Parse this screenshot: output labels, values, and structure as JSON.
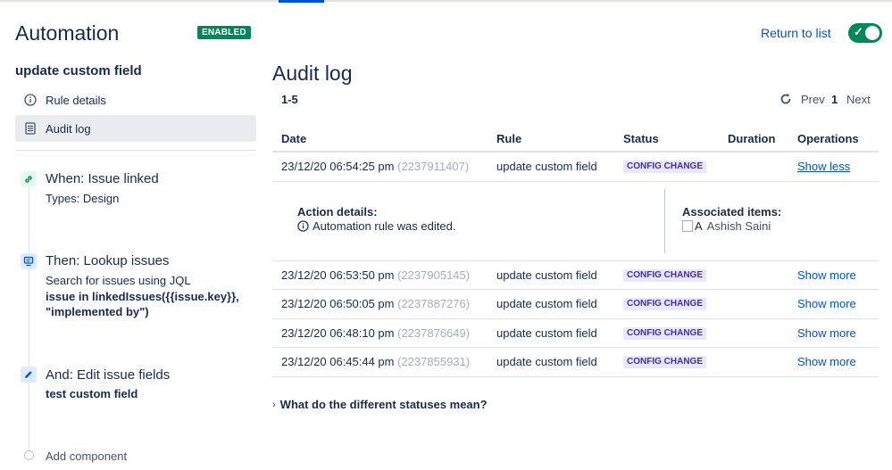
{
  "header": {
    "title": "Automation",
    "badge": "ENABLED",
    "return_link": "Return to list",
    "toggle_on": true
  },
  "sidebar": {
    "rule_name": "update custom field",
    "nav": [
      {
        "label": "Rule details",
        "icon": "info-icon"
      },
      {
        "label": "Audit log",
        "icon": "document-icon"
      }
    ],
    "components": [
      {
        "title": "When: Issue linked",
        "sub": "Types: Design",
        "icon": "link-icon"
      },
      {
        "title": "Then: Lookup issues",
        "sub": "Search for issues using JQL",
        "bold_line1": "issue in linkedIssues({{issue.key}},",
        "bold_line2": "\"implemented by\")",
        "icon": "monitor-icon"
      },
      {
        "title": "And: Edit issue fields",
        "bold_line1": "test custom field",
        "icon": "pencil-icon"
      }
    ],
    "add_component": "Add component"
  },
  "main": {
    "title": "Audit log",
    "range": "1-5",
    "pagination": {
      "prev": "Prev",
      "page": "1",
      "next": "Next"
    },
    "columns": [
      "Date",
      "Rule",
      "Status",
      "Duration",
      "Operations"
    ],
    "rows": [
      {
        "date": "23/12/20 06:54:25 pm",
        "id": "(2237911407)",
        "rule": "update custom field",
        "status": "CONFIG CHANGE",
        "duration": "",
        "op": "Show less"
      },
      {
        "date": "23/12/20 06:53:50 pm",
        "id": "(2237905145)",
        "rule": "update custom field",
        "status": "CONFIG CHANGE",
        "duration": "",
        "op": "Show more"
      },
      {
        "date": "23/12/20 06:50:05 pm",
        "id": "(2237887276)",
        "rule": "update custom field",
        "status": "CONFIG CHANGE",
        "duration": "",
        "op": "Show more"
      },
      {
        "date": "23/12/20 06:48:10 pm",
        "id": "(2237876649)",
        "rule": "update custom field",
        "status": "CONFIG CHANGE",
        "duration": "",
        "op": "Show more"
      },
      {
        "date": "23/12/20 06:45:44 pm",
        "id": "(2237855931)",
        "rule": "update custom field",
        "status": "CONFIG CHANGE",
        "duration": "",
        "op": "Show more"
      }
    ],
    "details": {
      "action_label": "Action details:",
      "action_text": "Automation rule was edited.",
      "assoc_label": "Associated items:",
      "assoc_alt": "A",
      "assoc_name": "Ashish Saini"
    },
    "faq": "What do the different statuses mean?"
  },
  "colors": {
    "accent": "#0052cc",
    "enabled_green": "#00875a",
    "lozenge_bg": "#eae6ff",
    "lozenge_text": "#403294"
  }
}
